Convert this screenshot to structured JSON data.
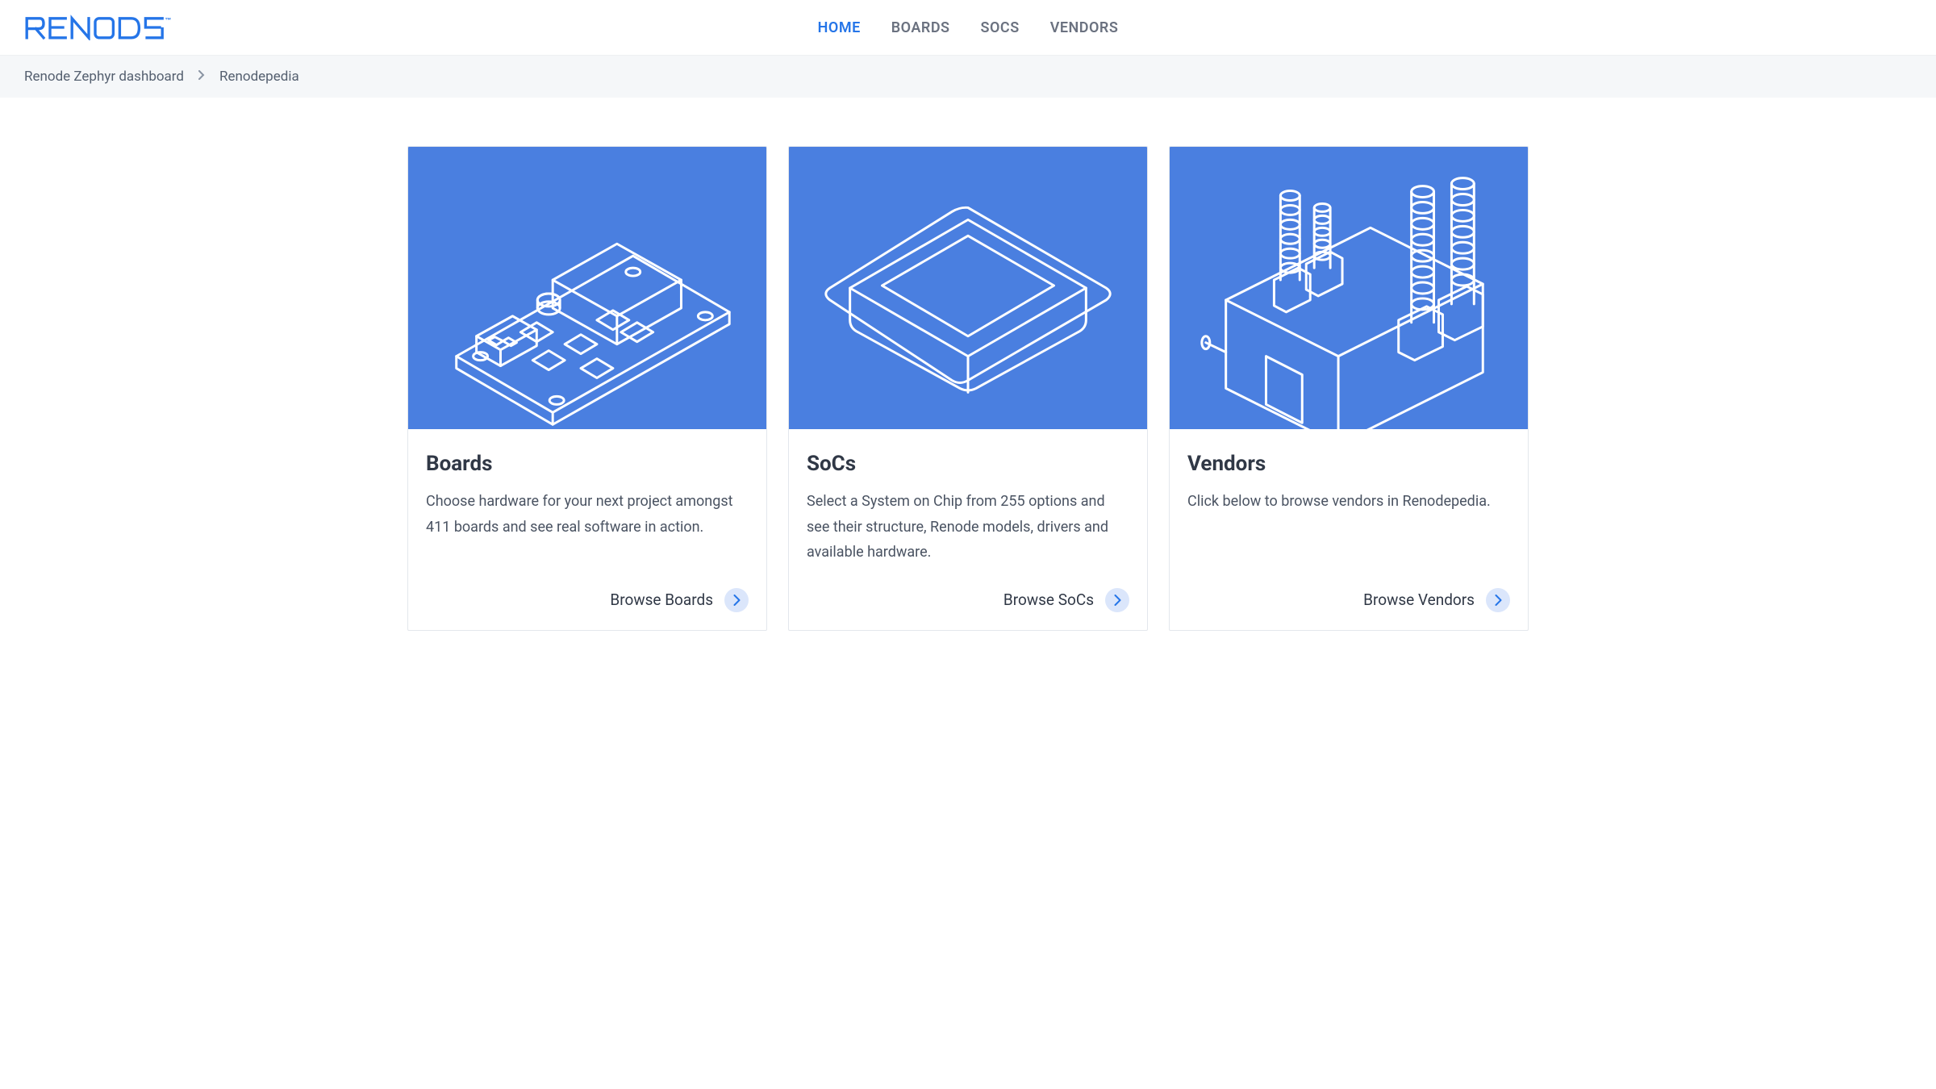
{
  "brand": {
    "name": "RENODE",
    "trademark": "™"
  },
  "nav": {
    "items": [
      {
        "label": "HOME",
        "active": true
      },
      {
        "label": "BOARDS",
        "active": false
      },
      {
        "label": "SOCS",
        "active": false
      },
      {
        "label": "VENDORS",
        "active": false
      }
    ]
  },
  "breadcrumb": {
    "items": [
      {
        "label": "Renode Zephyr dashboard"
      },
      {
        "label": "Renodepedia"
      }
    ]
  },
  "cards": [
    {
      "title": "Boards",
      "description": "Choose hardware for your next project amongst 411 boards and see real software in action.",
      "link_text": "Browse Boards",
      "icon": "board-icon"
    },
    {
      "title": "SoCs",
      "description": "Select a System on Chip from 255 options and see their structure, Renode models, drivers and avail­able hardware.",
      "link_text": "Browse SoCs",
      "icon": "soc-icon"
    },
    {
      "title": "Vendors",
      "description": "Click below to browse vendors in Renodepedia.",
      "link_text": "Browse Vendors",
      "icon": "vendor-icon"
    }
  ],
  "colors": {
    "primary": "#2575e8",
    "card_bg": "#4a7fe0",
    "text": "#303846",
    "muted": "#6b7280",
    "breadcrumb_bg": "#f5f7f9"
  }
}
